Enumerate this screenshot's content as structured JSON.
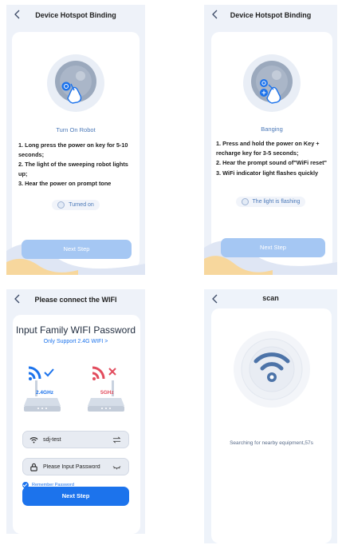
{
  "screen1": {
    "title": "Device Hotspot Binding",
    "step_title": "Turn On Robot",
    "instructions": [
      "1. Long press the power on key for 5-10 seconds;",
      "2. The light of the sweeping robot lights up;",
      "3. Hear the power on prompt tone"
    ],
    "confirm_label": "Turned on",
    "next_label": "Next Step"
  },
  "screen2": {
    "title": "Device Hotspot Binding",
    "step_title": "Banging",
    "instructions": [
      "1. Press and hold the power on Key + recharge key for 3-5 seconds;",
      "2. Hear the prompt sound of\"WiFi reset\"",
      "3. WiFi indicator light flashes quickly"
    ],
    "confirm_label": "The light is flashing",
    "next_label": "Next Step"
  },
  "screen3": {
    "title": "Please connect the WIFI",
    "heading": "Input Family WIFI Password",
    "support_link": "Only Support 2.4G WIFI >",
    "band_ok": "2.4GHz",
    "band_bad": "5GHz",
    "wifi_name": "sdj-test",
    "password_placeholder": "Please Input Password",
    "remember_label": "Remember Password",
    "next_label": "Next Step"
  },
  "screen4": {
    "title": "scan",
    "status": "Searching for nearby equipment,57s"
  },
  "colors": {
    "accent": "#1c73ec",
    "button_disabled": "#a5c7f3",
    "link_text": "#4a78b8",
    "error": "#e24c5d"
  }
}
